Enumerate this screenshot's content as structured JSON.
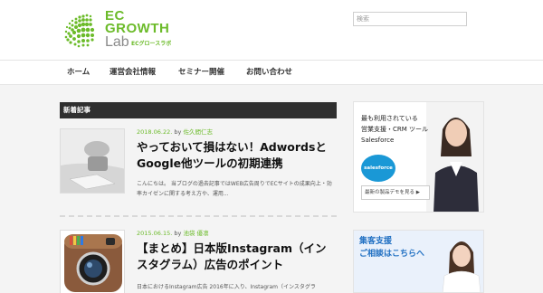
{
  "logo": {
    "line1": "EC",
    "line2": "GROWTH",
    "line3": "Lab",
    "sub": "ECグロースラボ"
  },
  "search": {
    "placeholder": "検索"
  },
  "nav": {
    "items": [
      {
        "label": "ホーム"
      },
      {
        "label": "運営会社情報"
      },
      {
        "label": "セミナー開催"
      },
      {
        "label": "お問い合わせ"
      }
    ]
  },
  "section": {
    "title": "新着記事"
  },
  "posts": [
    {
      "date": "2018.06.22.",
      "by": "by",
      "author": "佐久間仁志",
      "title": "やっておいて損はない！AdwordsとGoogle他ツールの初期連携",
      "excerpt": "こんにちは。 当ブログの過去記事ではWEB広告周りでECサイトの成果向上・効率カイゼンに関する考え方や、運用..."
    },
    {
      "date": "2015.06.15.",
      "by": "by",
      "author": "池袋 優凛",
      "title": "【まとめ】日本版Instagram（インスタグラム）広告のポイント",
      "excerpt": "日本におけるInstagram広告 2016年に入り、Instagram（インスタグラ"
    }
  ],
  "ads": [
    {
      "line1": "最も利用されている",
      "line2": "営業支援・CRM ツール",
      "line3": "Salesforce",
      "brand": "salesforce",
      "cta": "最新の製品デモを見る ▶"
    },
    {
      "line1": "集客支援",
      "line2": "ご相談はこちらへ"
    }
  ],
  "colors": {
    "accent": "#6cbb2a",
    "section_bg": "#2f2f2f",
    "ad_blue": "#1a98d6"
  }
}
